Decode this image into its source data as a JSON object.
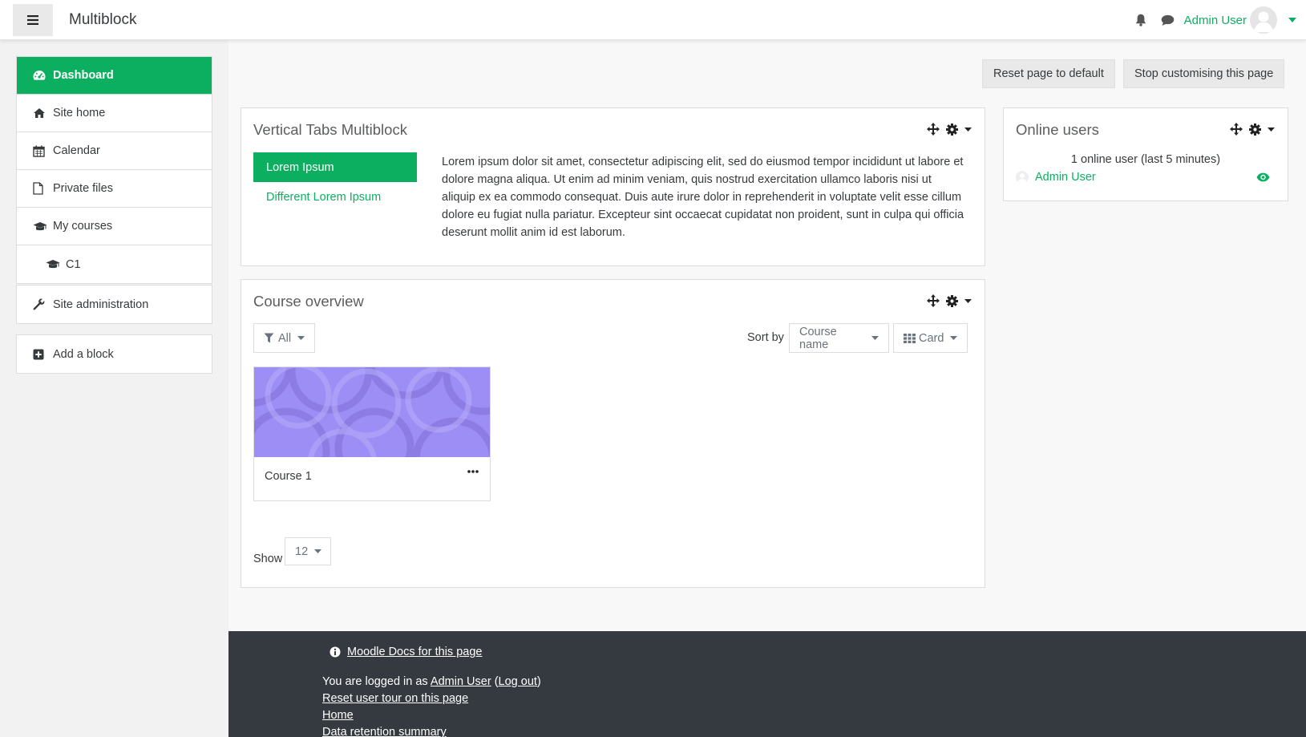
{
  "navbar": {
    "brand": "Multiblock",
    "user_name": "Admin User"
  },
  "drawer": {
    "nav_items": [
      {
        "label": "Dashboard",
        "icon": "dashboard-icon",
        "active": true
      },
      {
        "label": "Site home",
        "icon": "home-icon"
      },
      {
        "label": "Calendar",
        "icon": "calendar-icon"
      },
      {
        "label": "Private files",
        "icon": "file-icon"
      },
      {
        "label": "My courses",
        "icon": "graduation-cap-icon"
      },
      {
        "label": "C1",
        "icon": "graduation-cap-icon"
      }
    ],
    "site_admin": "Site administration",
    "add_block": "Add a block"
  },
  "page_buttons": {
    "reset": "Reset page to default",
    "stop": "Stop customising this page"
  },
  "multiblock": {
    "title": "Vertical Tabs Multiblock",
    "tabs": [
      {
        "label": "Lorem Ipsum",
        "active": true
      },
      {
        "label": "Different Lorem Ipsum",
        "active": false
      }
    ],
    "content": "Lorem ipsum dolor sit amet, consectetur adipiscing elit, sed do eiusmod tempor incididunt ut labore et dolore magna aliqua. Ut enim ad minim veniam, quis nostrud exercitation ullamco laboris nisi ut aliquip ex ea commodo consequat. Duis aute irure dolor in reprehenderit in voluptate velit esse cillum dolore eu fugiat nulla pariatur. Excepteur sint occaecat cupidatat non proident, sunt in culpa qui officia deserunt mollit anim id est laborum."
  },
  "online_users": {
    "title": "Online users",
    "count_text": "1 online user (last 5 minutes)",
    "user": "Admin User"
  },
  "course_overview": {
    "title": "Course overview",
    "filter": "All",
    "sort_by_label": "Sort by",
    "sort_value": "Course name",
    "view_value": "Card",
    "course_name": "Course 1",
    "show_label": "Show",
    "show_value": "12"
  },
  "footer": {
    "docs_link": "Moodle Docs for this page",
    "logged_in_prefix": "You are logged in as",
    "logged_in_user": "Admin User",
    "logout": "Log out",
    "reset_tour": "Reset user tour on this page",
    "home": "Home",
    "data_retention": "Data retention summary"
  },
  "colors": {
    "accent": "#0caf60",
    "footer_bg": "#343a40",
    "course_image": "#9d8ef5"
  }
}
